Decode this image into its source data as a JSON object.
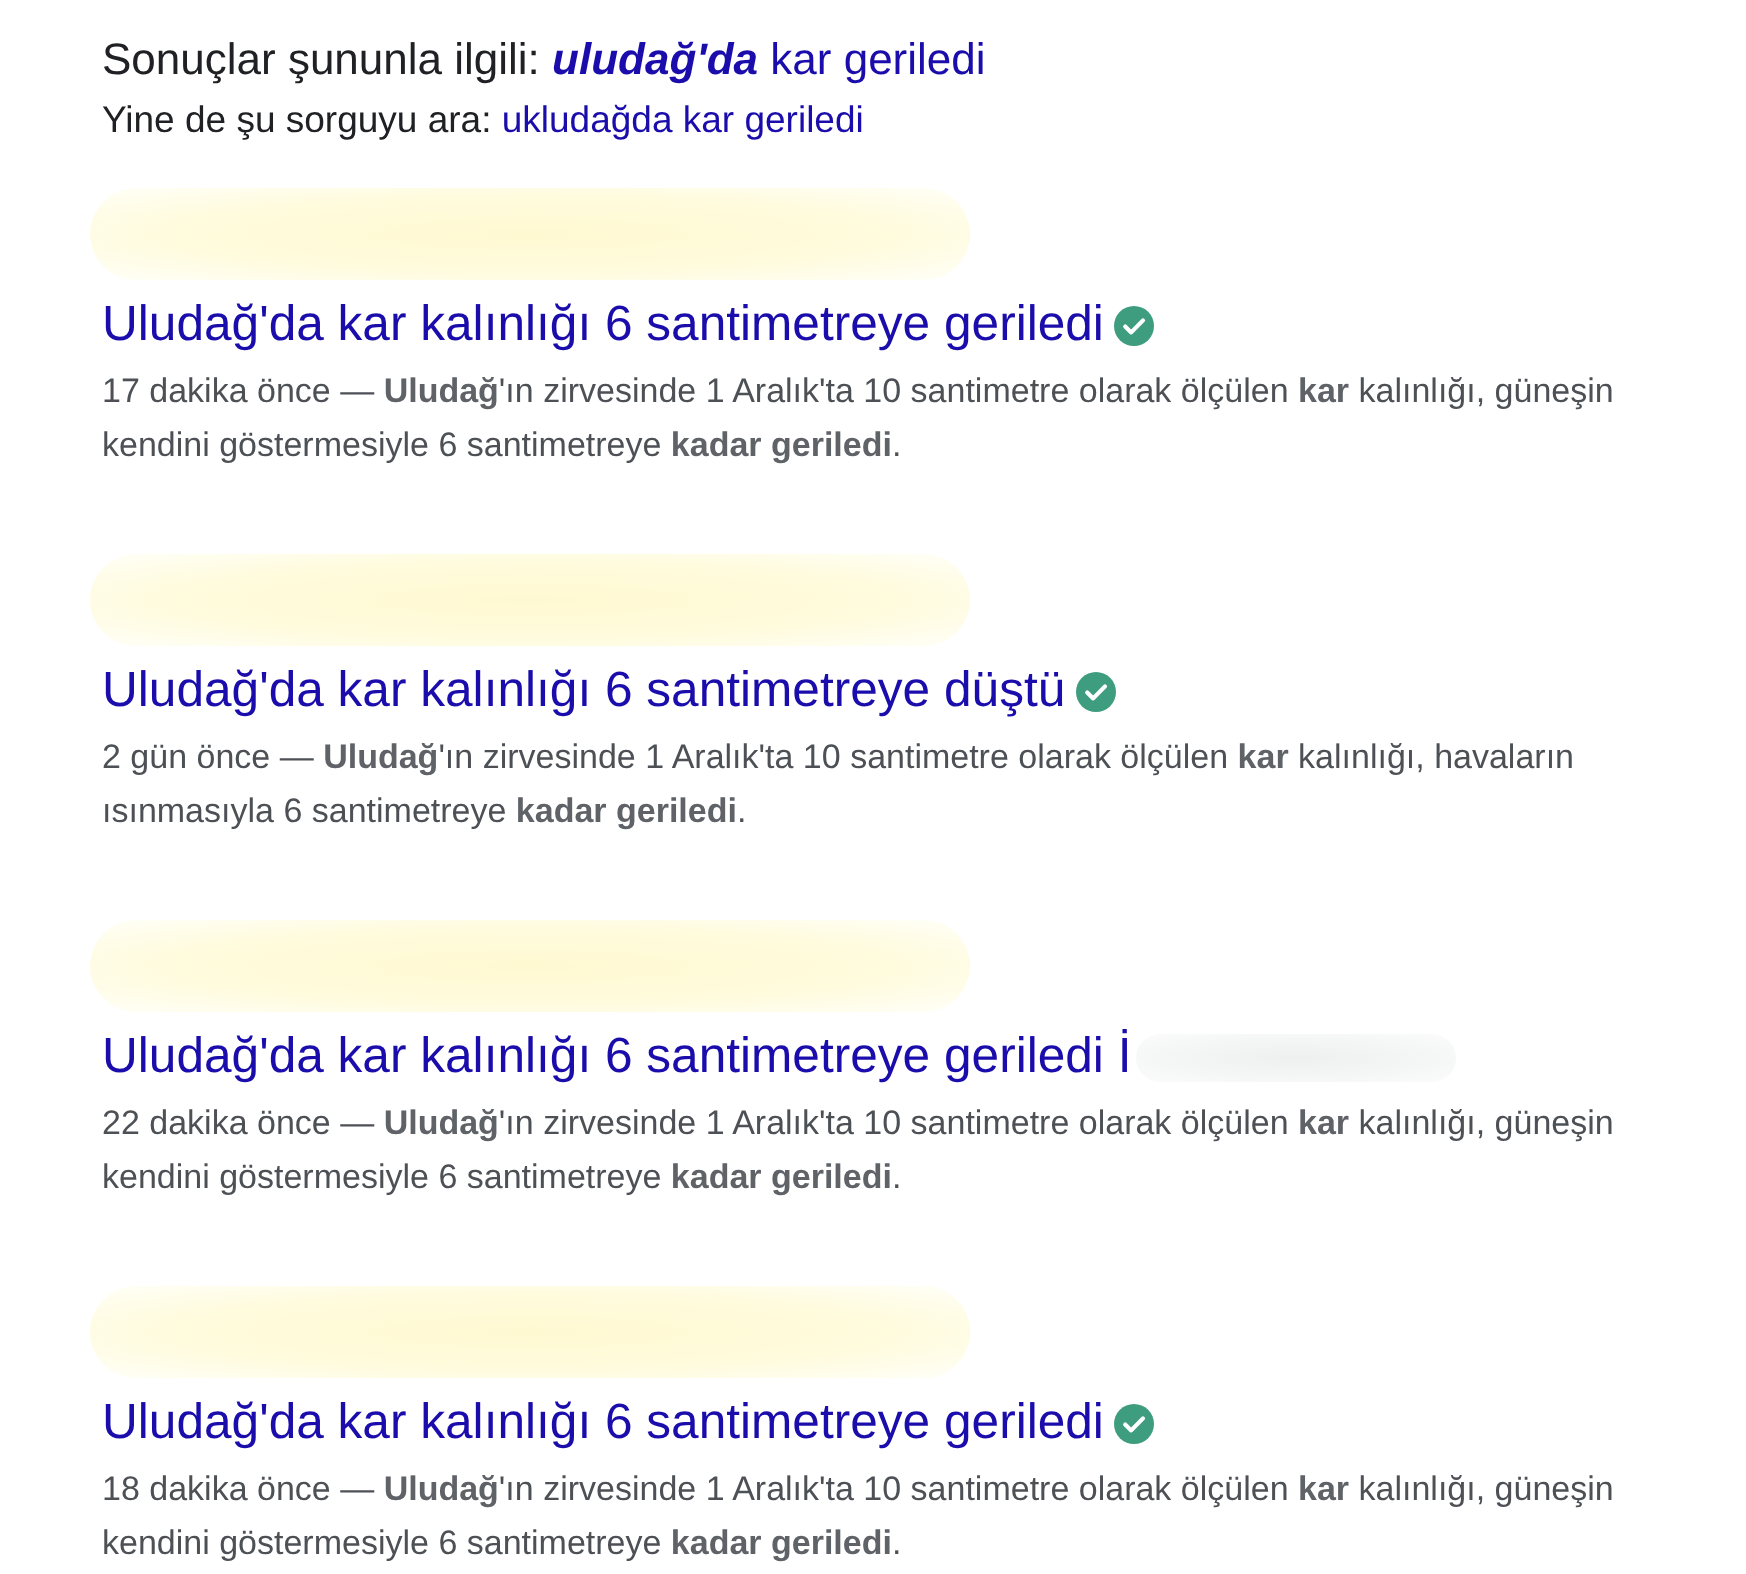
{
  "correction": {
    "label": "Sonuçlar şununla ilgili:",
    "query": "**uludağ'da** kar geriledi"
  },
  "original_query": {
    "label": "Yine de şu sorguyu ara:",
    "query": "ukludağda kar geriledi"
  },
  "results": [
    {
      "source_redacted": true,
      "title": "Uludağ'da kar kalınlığı 6 santimetreye geriledi",
      "verified": true,
      "title_redacted": false,
      "snippet": "17 dakika önce — **Uludağ**'ın zirvesinde 1 Aralık'ta 10 santimetre olarak ölçülen **kar** kalınlığı, güneşin kendini göstermesiyle 6 santimetreye **kadar geriledi**."
    },
    {
      "source_redacted": true,
      "title": "Uludağ'da kar kalınlığı 6 santimetreye düştü",
      "verified": true,
      "title_redacted": false,
      "snippet": "2 gün önce — **Uludağ**'ın zirvesinde 1 Aralık'ta 10 santimetre olarak ölçülen **kar** kalınlığı, havaların ısınmasıyla 6 santimetreye **kadar geriledi**."
    },
    {
      "source_redacted": true,
      "title": "Uludağ'da kar kalınlığı 6 santimetreye geriledi İ",
      "verified": false,
      "title_redacted": true,
      "snippet": "22 dakika önce — **Uludağ**'ın zirvesinde 1 Aralık'ta 10 santimetre olarak ölçülen **kar** kalınlığı, güneşin kendini göstermesiyle 6 santimetreye **kadar geriledi**."
    },
    {
      "source_redacted": true,
      "title": "Uludağ'da kar kalınlığı 6 santimetreye geriledi",
      "verified": true,
      "title_redacted": false,
      "snippet": "18 dakika önce — **Uludağ**'ın zirvesinde 1 Aralık'ta 10 santimetre olarak ölçülen **kar** kalınlığı, güneşin kendini göstermesiyle 6 santimetreye **kadar geriledi**."
    }
  ]
}
